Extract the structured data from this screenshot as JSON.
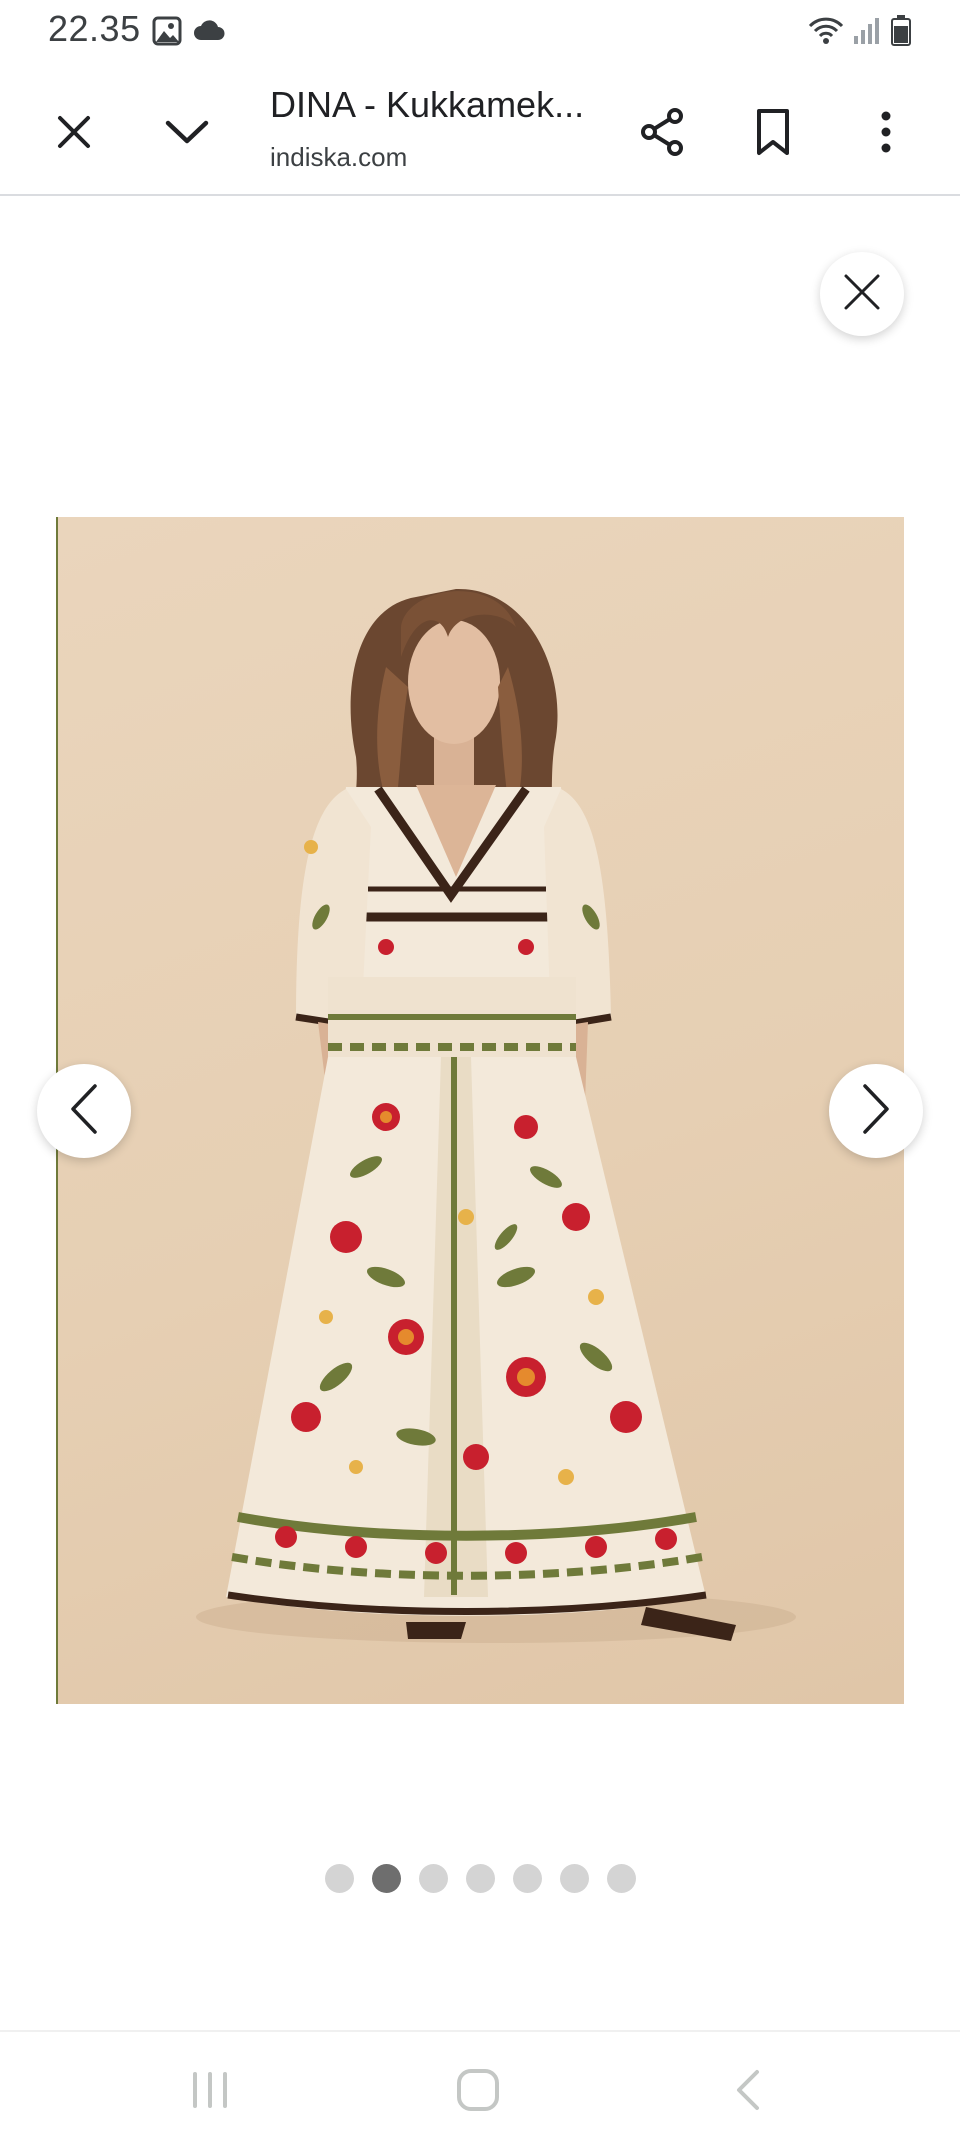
{
  "status_bar": {
    "time": "22.35",
    "icons": [
      "gallery-icon",
      "cloud-icon",
      "wifi-icon",
      "signal-icon",
      "battery-icon"
    ]
  },
  "toolbar": {
    "title": "DINA - Kukkamek...",
    "domain": "indiska.com",
    "buttons": [
      "close-icon",
      "chevron-down-icon",
      "share-icon",
      "bookmark-icon",
      "more-vert-icon"
    ]
  },
  "viewer": {
    "image_alt": "Floral print maxi dress",
    "image_count": 7,
    "current_index": 1,
    "colors": {
      "backdrop": "#e8d3b9",
      "dress_cream": "#f3e9da",
      "accent_red": "#c8202e",
      "accent_green": "#6f7a3a",
      "trim_brown": "#3b2418"
    }
  },
  "system_nav": {
    "buttons": [
      "recents-icon",
      "home-icon",
      "back-icon"
    ]
  }
}
